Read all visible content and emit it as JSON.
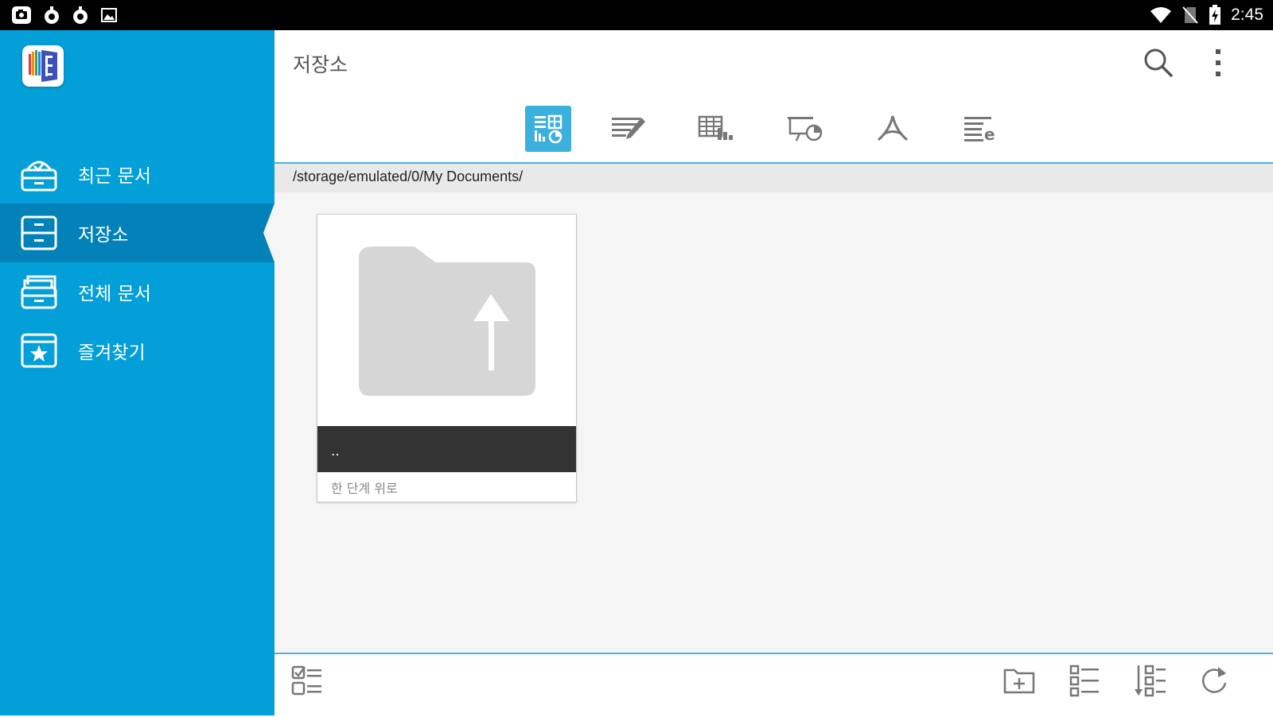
{
  "status_bar": {
    "time": "2:45",
    "left_icons": [
      "camera-badge-icon",
      "notification-dot-icon",
      "notification-dot-icon",
      "image-icon"
    ],
    "right_icons": [
      "wifi-icon",
      "no-sim-icon",
      "battery-charging-icon"
    ]
  },
  "sidebar": {
    "app_logo": "polaris-viewer-logo",
    "items": [
      {
        "label": "최근 문서",
        "icon": "recent-documents-icon",
        "active": false
      },
      {
        "label": "저장소",
        "icon": "storage-icon",
        "active": true
      },
      {
        "label": "전체 문서",
        "icon": "all-documents-icon",
        "active": false
      },
      {
        "label": "즐겨찾기",
        "icon": "favorites-icon",
        "active": false
      }
    ]
  },
  "header": {
    "title": "저장소",
    "actions": [
      "search-icon",
      "more-vert-icon"
    ]
  },
  "filter_tabs": [
    {
      "icon": "all-types-icon",
      "selected": true
    },
    {
      "icon": "word-document-icon",
      "selected": false
    },
    {
      "icon": "spreadsheet-icon",
      "selected": false
    },
    {
      "icon": "presentation-icon",
      "selected": false
    },
    {
      "icon": "pdf-icon",
      "selected": false
    },
    {
      "icon": "text-file-icon",
      "selected": false
    }
  ],
  "path": "/storage/emulated/0/My Documents/",
  "files": [
    {
      "name": "..",
      "description": "한 단계 위로",
      "icon": "folder-up-icon"
    }
  ],
  "bottom_bar": {
    "left": [
      "multi-select-icon"
    ],
    "right": [
      "new-folder-icon",
      "list-view-icon",
      "sort-icon",
      "refresh-icon"
    ]
  },
  "colors": {
    "sidebar": "#039fd8",
    "sidebar_active": "#0282b8",
    "accent": "#3bb0dc",
    "name_bar": "#333333"
  }
}
